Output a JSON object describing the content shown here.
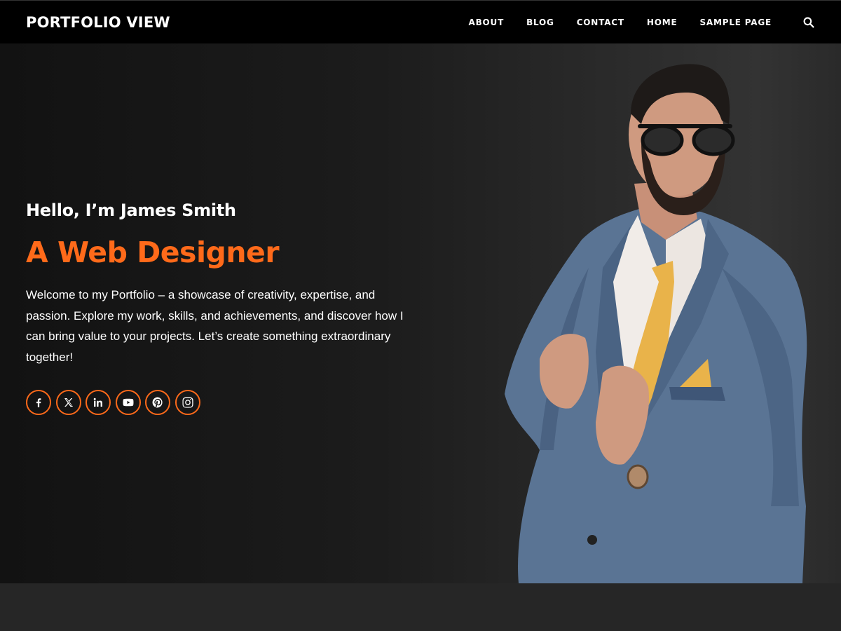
{
  "header": {
    "logo": "PORTFOLIO VIEW",
    "nav": [
      "ABOUT",
      "BLOG",
      "CONTACT",
      "HOME",
      "SAMPLE PAGE"
    ],
    "search_icon": "search-icon"
  },
  "hero": {
    "greeting": "Hello, I’m James Smith",
    "role": "A Web Designer",
    "intro": "Welcome to my Portfolio – a showcase of creativity, expertise, and passion. Explore my work, skills, and achievements, and discover how I can bring value to your projects. Let’s create something extraordinary together!",
    "socials": [
      "facebook-icon",
      "x-icon",
      "linkedin-icon",
      "youtube-icon",
      "pinterest-icon",
      "instagram-icon"
    ]
  },
  "colors": {
    "accent": "#ff6a1a",
    "header_bg": "#000000",
    "hero_bg": "#1c1c1c"
  }
}
